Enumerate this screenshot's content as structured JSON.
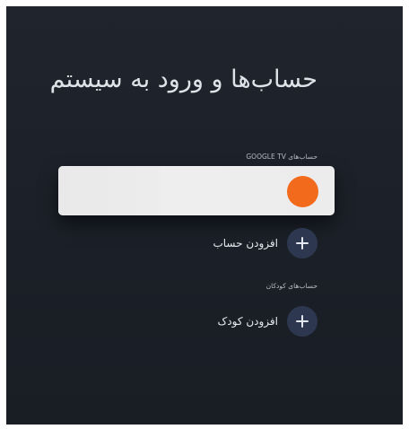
{
  "header": {
    "title": "حساب‌ها و ورود به سیستم"
  },
  "sections": {
    "google_tv_label": "حساب‌های GOOGLE TV",
    "kids_label": "حساب‌های کودکان"
  },
  "account": {
    "avatar_color": "#f26b1d"
  },
  "actions": {
    "add_account": "افزودن حساب",
    "add_kid": "افزودن کودک"
  },
  "icons": {
    "add": "plus-icon"
  }
}
